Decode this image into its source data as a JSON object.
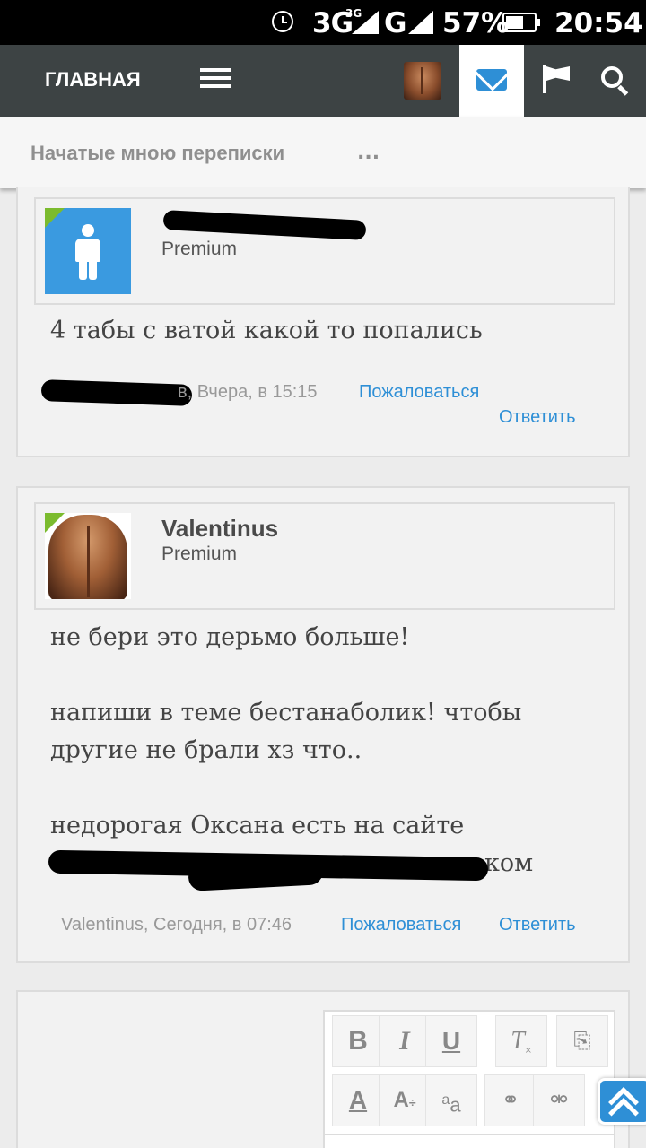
{
  "status_bar": {
    "network": "3G",
    "network_sup": "3G",
    "network2": "G",
    "battery": "57%",
    "time": "20:54"
  },
  "nav": {
    "home_label": "ГЛАВНАЯ"
  },
  "breadcrumb": {
    "current": "Начатые мною переписки",
    "more": "..."
  },
  "messages": [
    {
      "author": "",
      "title": "Premium",
      "text": "4 табы с ватой какой то попались",
      "meta": "в, Вчера, в 15:15",
      "report_label": "Пожаловаться",
      "reply_label": "Ответить"
    },
    {
      "author": "Valentinus",
      "title": "Premium",
      "text_lines": [
        "не бери это дерьмо больше!",
        "напиши в теме бестанаболик! чтобы",
        "другие не брали хз что..",
        "недорогая Оксана есть на сайте",
        "ком"
      ],
      "meta": "Valentinus, Сегодня, в 07:46",
      "report_label": "Пожаловаться",
      "reply_label": "Ответить"
    }
  ],
  "editor": {
    "tools": [
      "B",
      "I",
      "U",
      "T",
      "A",
      "A",
      "a",
      "a"
    ]
  },
  "colors": {
    "accent": "#2e8fd6",
    "nav_bg": "#3d4344",
    "online": "#7bbb2e"
  }
}
